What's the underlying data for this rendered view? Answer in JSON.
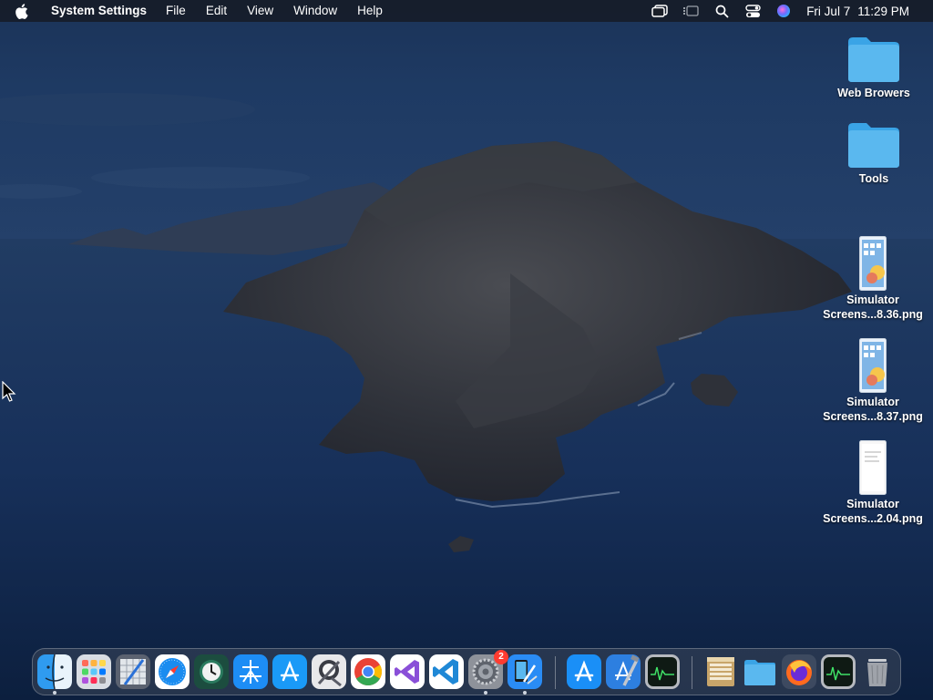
{
  "menubar": {
    "app_name": "System Settings",
    "menus": [
      "File",
      "Edit",
      "View",
      "Window",
      "Help"
    ],
    "date": "Fri Jul 7",
    "time": "11:29 PM",
    "status_icons": [
      "screen-mirroring-icon",
      "stage-manager-icon",
      "spotlight-search-icon",
      "control-center-icon",
      "siri-icon"
    ]
  },
  "desktop_icons": [
    {
      "label1": "Web Browers",
      "label2": "",
      "kind": "folder"
    },
    {
      "label1": "Tools",
      "label2": "",
      "kind": "folder"
    },
    {
      "label1": "Simulator",
      "label2": "Screens...8.36.png",
      "kind": "screenshot"
    },
    {
      "label1": "Simulator",
      "label2": "Screens...8.37.png",
      "kind": "screenshot"
    },
    {
      "label1": "Simulator",
      "label2": "Screens...2.04.png",
      "kind": "screenshot-white"
    }
  ],
  "dock": {
    "items": [
      {
        "name": "finder",
        "running": true
      },
      {
        "name": "launchpad",
        "running": false
      },
      {
        "name": "pixelmator",
        "running": false
      },
      {
        "name": "safari",
        "running": false
      },
      {
        "name": "time-machine",
        "running": false
      },
      {
        "name": "testflight",
        "running": false
      },
      {
        "name": "app-store-connect",
        "running": false
      },
      {
        "name": "xcode-instruments",
        "running": false
      },
      {
        "name": "chrome",
        "running": false
      },
      {
        "name": "visual-studio",
        "running": false
      },
      {
        "name": "vscode",
        "running": false
      },
      {
        "name": "system-settings",
        "running": true,
        "badge": "2"
      },
      {
        "name": "simulator",
        "running": true
      },
      {
        "name": "app-store",
        "running": false
      },
      {
        "name": "xcode",
        "running": false
      },
      {
        "name": "activity-monitor",
        "running": false
      },
      {
        "name": "archive-utility",
        "running": false
      },
      {
        "name": "downloads-folder",
        "running": false
      },
      {
        "name": "firefox",
        "running": false
      },
      {
        "name": "activity-monitor-2",
        "running": false
      },
      {
        "name": "trash",
        "running": false
      }
    ]
  },
  "colors": {
    "folder": "#5ab8ef",
    "badge": "#ff3b30"
  }
}
